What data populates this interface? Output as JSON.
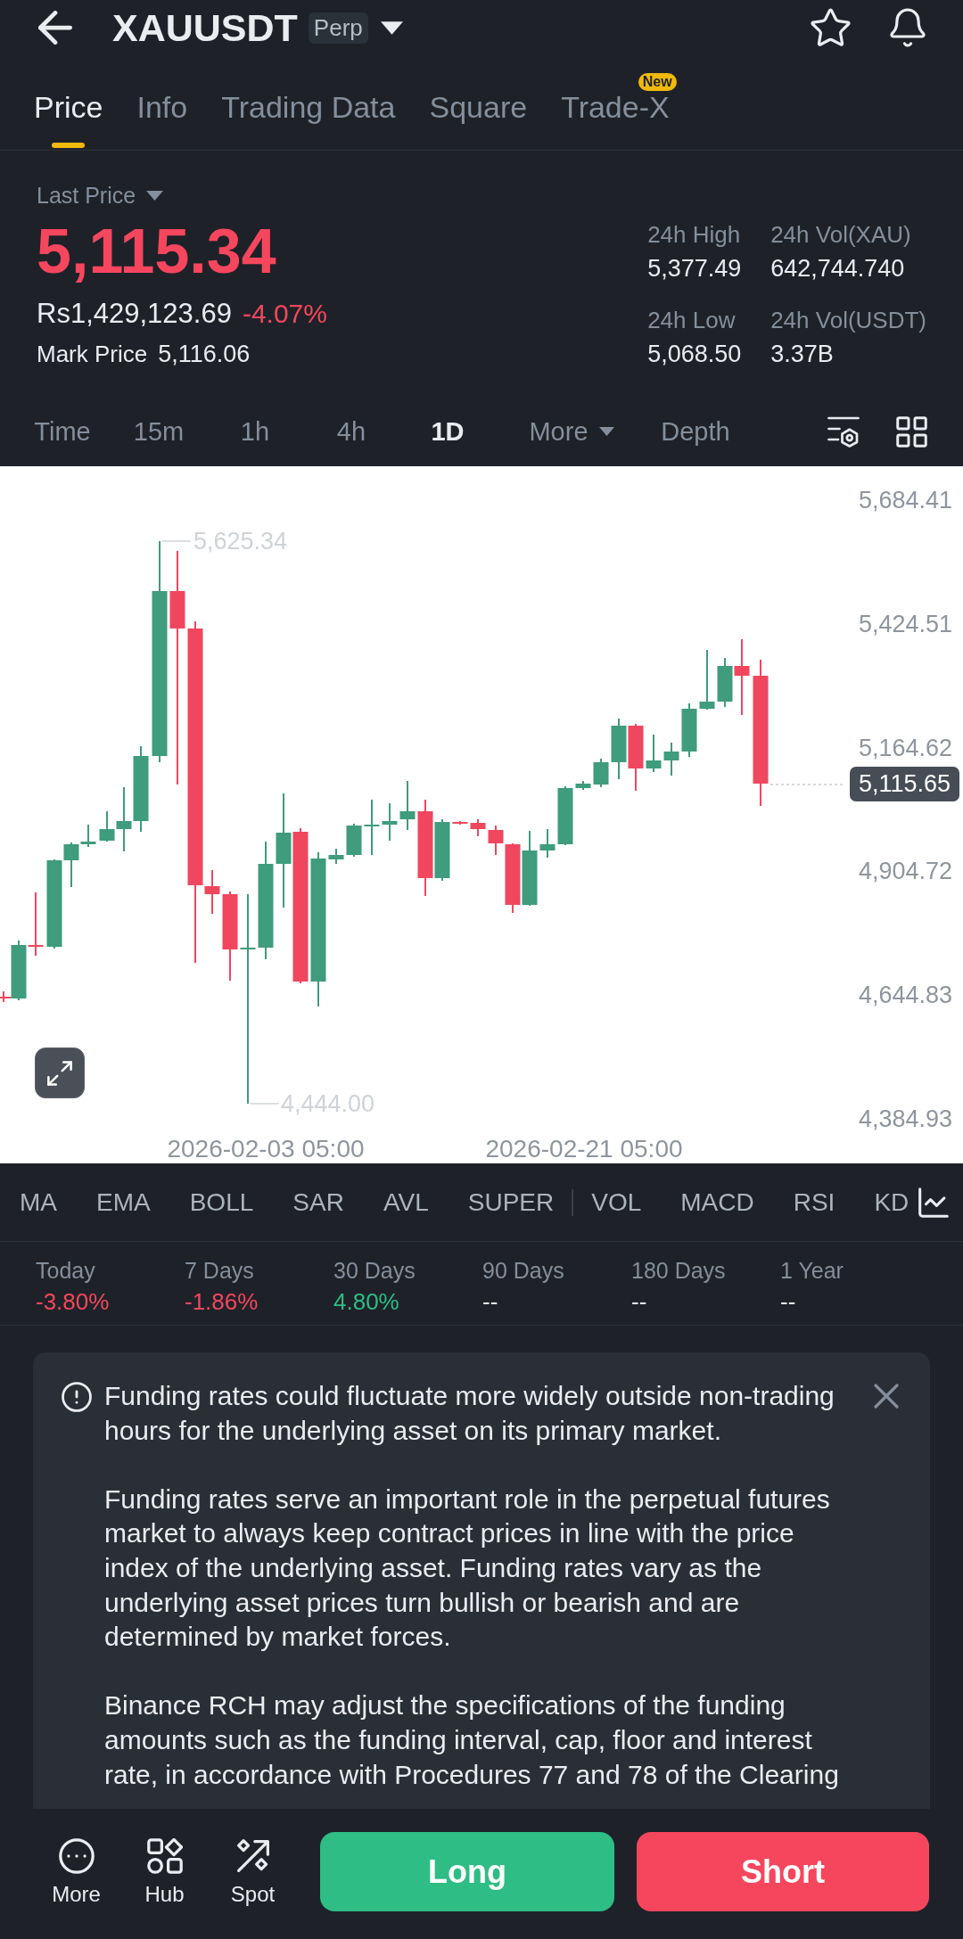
{
  "header": {
    "title": "XAUUSDT",
    "badge": "Perp"
  },
  "tabs": [
    {
      "label": "Price",
      "selected": true
    },
    {
      "label": "Info",
      "selected": false
    },
    {
      "label": "Trading Data",
      "selected": false
    },
    {
      "label": "Square",
      "selected": false
    },
    {
      "label": "Trade-X",
      "selected": false,
      "badge": "New"
    }
  ],
  "ticker": {
    "last_price_label": "Last Price",
    "last_price": "5,115.34",
    "fiat_price": "Rs1,429,123.69",
    "change": "-4.07%",
    "mark_price_label": "Mark Price",
    "mark_price": "5,116.06",
    "stats": [
      {
        "label": "24h High",
        "value": "5,377.49"
      },
      {
        "label": "24h Vol(XAU)",
        "value": "642,744.740"
      },
      {
        "label": "24h Low",
        "value": "5,068.50"
      },
      {
        "label": "24h Vol(USDT)",
        "value": "3.37B"
      }
    ]
  },
  "intervals": [
    {
      "label": "Time",
      "kind": "option",
      "selected": false
    },
    {
      "label": "15m",
      "kind": "option",
      "selected": false
    },
    {
      "label": "1h",
      "kind": "option",
      "selected": false
    },
    {
      "label": "4h",
      "kind": "option",
      "selected": false
    },
    {
      "label": "1D",
      "kind": "option",
      "selected": true
    },
    {
      "label": "More",
      "kind": "dropdown",
      "selected": false
    },
    {
      "label": "Depth",
      "kind": "option",
      "selected": false
    }
  ],
  "chart": {
    "price_labels": [
      "5,684.41",
      "5,424.51",
      "5,164.62",
      "4,904.72",
      "4,644.83",
      "4,384.93"
    ],
    "time_labels": [
      "2026-02-03 05:00",
      "2026-02-21 05:00"
    ],
    "high_marker": "5,625.34",
    "low_marker": "4,444.00",
    "last_price_tag": "5,115.65"
  },
  "indicators": {
    "main": [
      "MA",
      "EMA",
      "BOLL",
      "SAR",
      "AVL",
      "SUPER"
    ],
    "sub": [
      "VOL",
      "MACD",
      "RSI",
      "KD"
    ]
  },
  "performance": [
    {
      "period": "Today",
      "value": "-3.80%",
      "color": "#f6465d"
    },
    {
      "period": "7 Days",
      "value": "-1.86%",
      "color": "#f6465d"
    },
    {
      "period": "30 Days",
      "value": "4.80%",
      "color": "#2ebd85"
    },
    {
      "period": "90 Days",
      "value": "--",
      "color": "#eaecef"
    },
    {
      "period": "180 Days",
      "value": "--",
      "color": "#eaecef"
    },
    {
      "period": "1 Year",
      "value": "--",
      "color": "#eaecef"
    }
  ],
  "notice": {
    "paragraphs": [
      "Funding rates could fluctuate more widely outside non-trading hours for the underlying asset on its primary market.",
      "Funding rates serve an important role in the perpetual futures market to always keep contract prices in line with the price index of the underlying asset. Funding rates vary as the underlying asset prices turn bullish or bearish and are determined by market forces.",
      "Binance RCH may adjust the specifications of the funding amounts such as the funding interval, cap, floor and interest rate, in accordance with Procedures 77 and 78 of the Clearing"
    ]
  },
  "bottom_bar": {
    "shortcuts": [
      {
        "kind": "dots",
        "label": "More"
      },
      {
        "kind": "tiles",
        "label": "Hub"
      },
      {
        "kind": "convert",
        "label": "Spot"
      }
    ],
    "long_button": "Long",
    "short_button": "Short"
  }
}
